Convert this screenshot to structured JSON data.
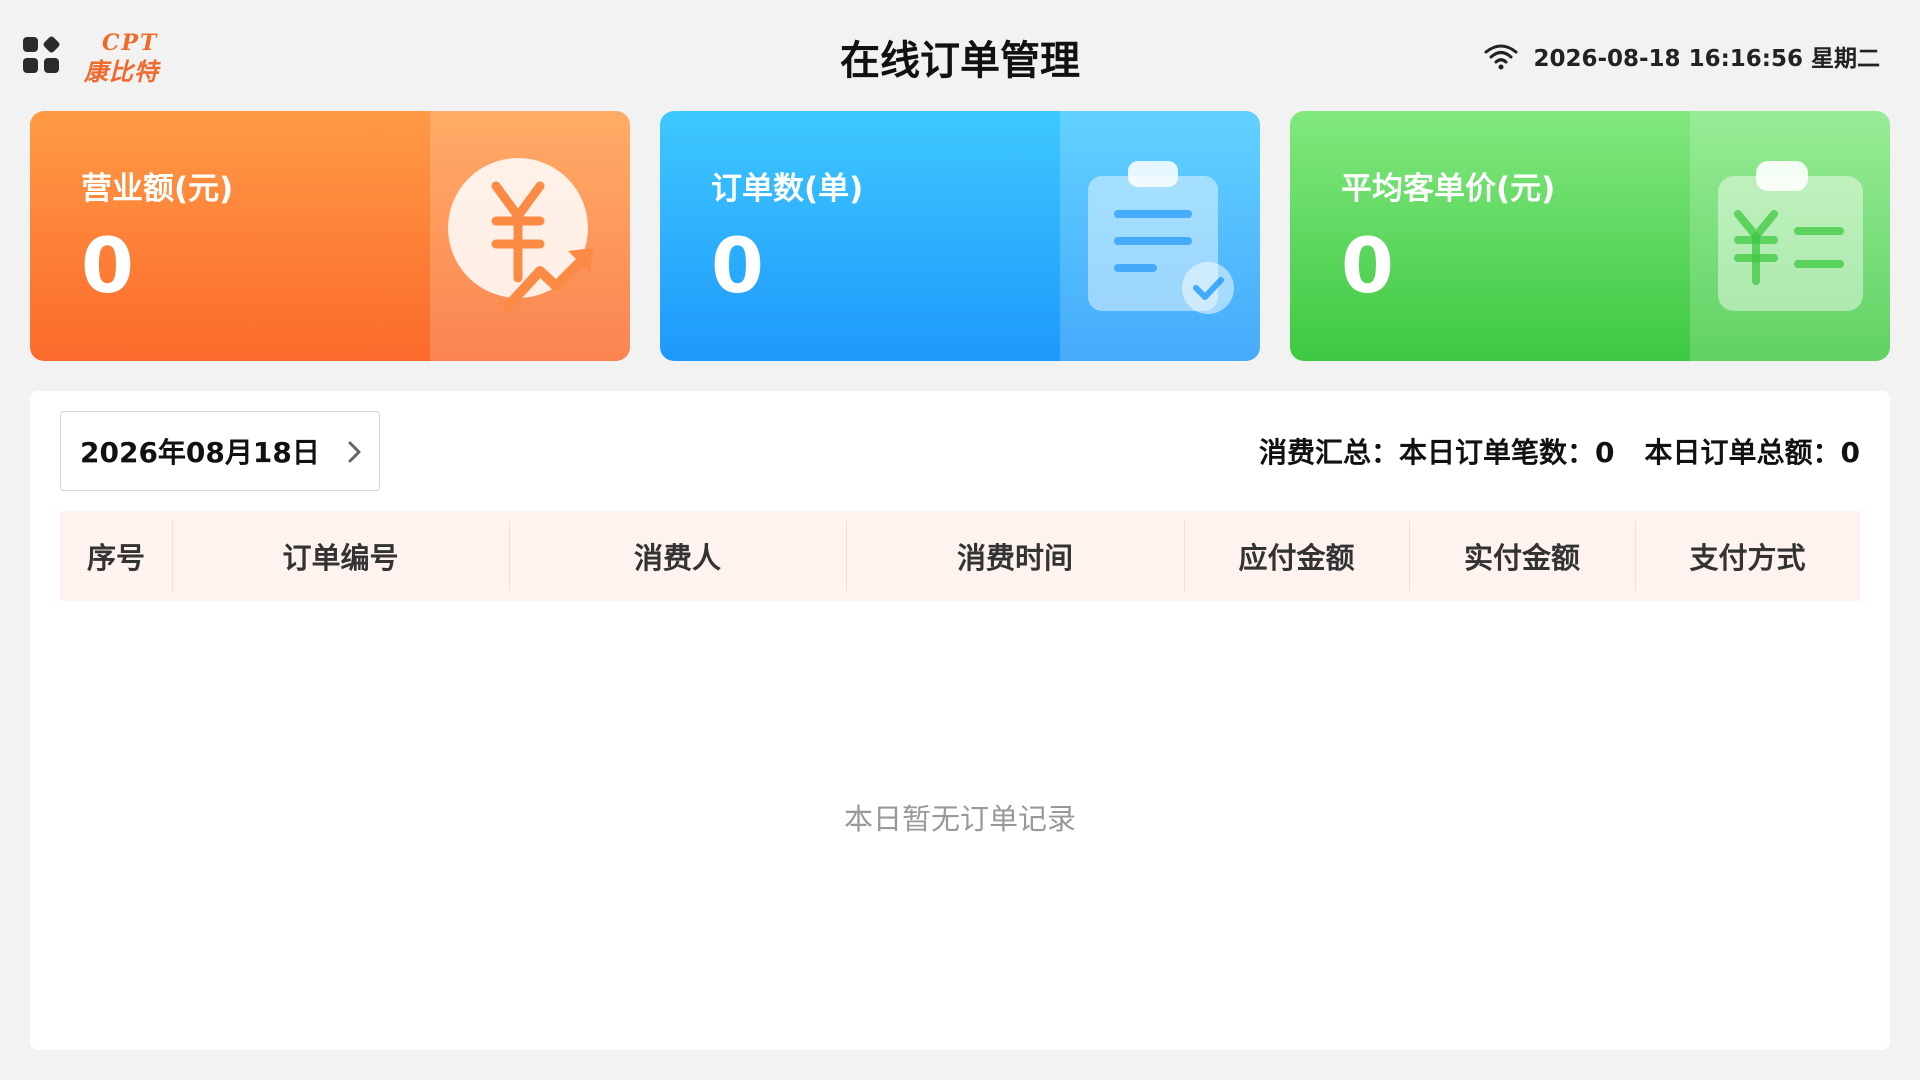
{
  "header": {
    "logo_en": "CPT",
    "logo_cn": "康比特",
    "title": "在线订单管理",
    "datetime": "2026-08-18 16:16:56 星期二"
  },
  "cards": [
    {
      "label": "营业额(元)",
      "value": "0",
      "icon": "yuan-trend-icon"
    },
    {
      "label": "订单数(单)",
      "value": "0",
      "icon": "clipboard-check-icon"
    },
    {
      "label": "平均客单价(元)",
      "value": "0",
      "icon": "clipboard-yuan-icon"
    }
  ],
  "filter": {
    "date": "2026年08月18日"
  },
  "summary": {
    "count": "消费汇总：本日订单笔数：0",
    "total": "本日订单总额：0"
  },
  "table": {
    "columns": [
      "序号",
      "订单编号",
      "消费人",
      "消费时间",
      "应付金额",
      "实付金额",
      "支付方式"
    ],
    "empty_text": "本日暂无订单记录"
  },
  "colors": {
    "brand": "#f06a2d",
    "card_orange": "#fb6a2c",
    "card_blue": "#1e98fb",
    "card_green": "#3ec842",
    "table_header_bg": "#fff3f0"
  }
}
